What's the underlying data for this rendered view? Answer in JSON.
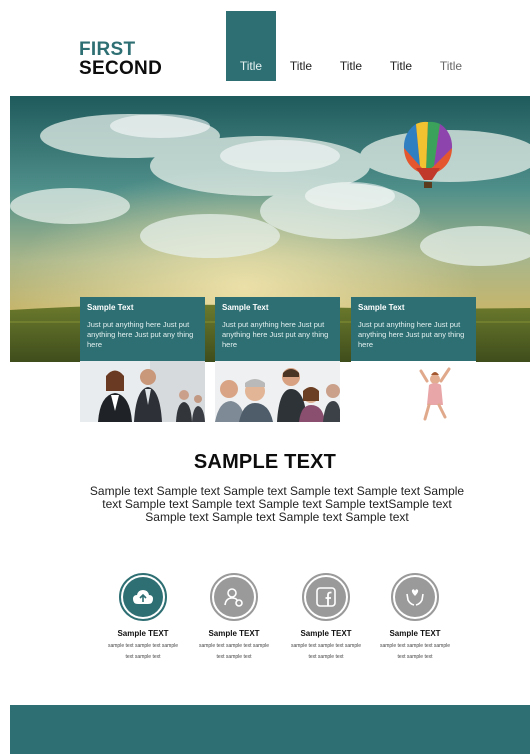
{
  "logo": {
    "line1": "FIRST",
    "line2": "SECOND"
  },
  "nav": [
    {
      "label": "Title"
    },
    {
      "label": "Title"
    },
    {
      "label": "Title"
    },
    {
      "label": "Title"
    },
    {
      "label": "Title"
    }
  ],
  "cards": [
    {
      "title": "Sample Text",
      "text": "Just put anything here Just put anything here Just put any thing here"
    },
    {
      "title": "Sample Text",
      "text": "Just put anything here Just put anything here Just put any thing here"
    },
    {
      "title": "Sample Text",
      "text": "Just put anything here Just put anything here Just put any thing here"
    }
  ],
  "headline": "SAMPLE TEXT",
  "body_text": "Sample text Sample text Sample text Sample text Sample text Sample text Sample text Sample text Sample text Sample textSample text Sample text Sample text Sample text Sample text",
  "services": [
    {
      "icon": "cloud-upload-icon",
      "title": "Sample TEXT",
      "text": "sample text sample text sample text sample text"
    },
    {
      "icon": "person-gear-icon",
      "title": "Sample TEXT",
      "text": "sample text sample text sample text sample text"
    },
    {
      "icon": "facebook-icon",
      "title": "Sample TEXT",
      "text": "sample text sample text sample text sample text"
    },
    {
      "icon": "hands-heart-icon",
      "title": "Sample TEXT",
      "text": "sample text sample text sample text sample text"
    }
  ],
  "colors": {
    "accent": "#2e6f73",
    "icon_gray": "#9a9a9a"
  }
}
